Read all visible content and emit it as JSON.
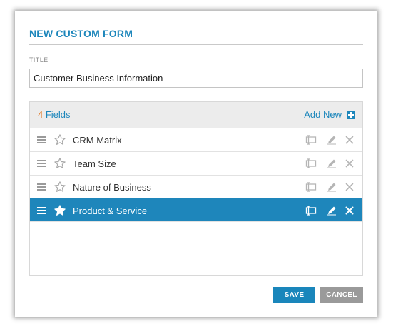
{
  "dialog": {
    "title": "NEW CUSTOM FORM",
    "title_label": "TITLE",
    "title_value": "Customer Business Information"
  },
  "fields_panel": {
    "count": "4",
    "count_label": "Fields",
    "add_new_label": "Add New",
    "items": [
      {
        "label": "CRM Matrix",
        "selected": false,
        "starred": false
      },
      {
        "label": "Team Size",
        "selected": false,
        "starred": false
      },
      {
        "label": "Nature of Business",
        "selected": false,
        "starred": false
      },
      {
        "label": "Product & Service",
        "selected": true,
        "starred": true
      }
    ]
  },
  "buttons": {
    "save_label": "SAVE",
    "cancel_label": "CANCEL"
  },
  "colors": {
    "accent": "#1c86bb",
    "count": "#e07b2a",
    "selected_row": "#1e86bb",
    "cancel": "#9a9a9a"
  },
  "icons": {
    "row": [
      "drag-handle-icon",
      "star-icon",
      "field-type-icon",
      "pencil-icon",
      "close-icon"
    ],
    "header": "plus-icon"
  }
}
